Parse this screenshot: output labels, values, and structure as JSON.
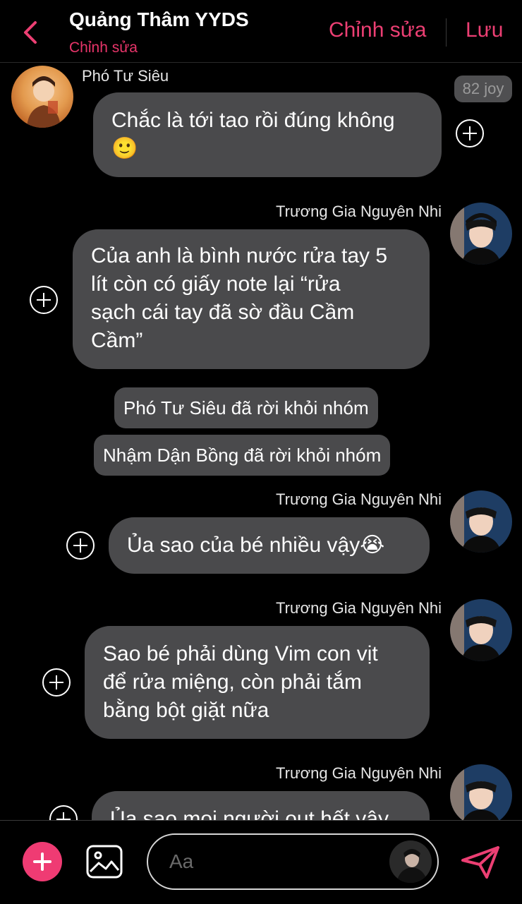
{
  "header": {
    "title": "Quảng Thâm YYDS",
    "subtitle": "Chỉnh sửa",
    "edit_label": "Chỉnh sửa",
    "save_label": "Lưu"
  },
  "messages": [
    {
      "sender": "Phó Tư Siêu",
      "lines": [
        "Chắc là tới tao rồi đúng không",
        "🙂"
      ],
      "reaction": "82 joy"
    },
    {
      "sender": "Trương Gia Nguyên Nhi",
      "lines": [
        "Của anh là bình nước rửa tay 5",
        "lít còn có giấy note lại “rửa",
        "sạch cái tay đã sờ đầu Cầm",
        "Cầm”"
      ]
    },
    {
      "system": "Phó Tư Siêu đã rời khỏi nhóm"
    },
    {
      "system": "Nhậm Dận Bồng đã rời khỏi nhóm"
    },
    {
      "sender": "Trương Gia Nguyên Nhi",
      "lines": [
        "Ủa sao của bé nhiều vậy😭"
      ]
    },
    {
      "sender": "Trương Gia Nguyên Nhi",
      "lines": [
        "Sao bé phải dùng Vim con vịt",
        "để rửa miệng, còn phải tắm",
        "bằng bột giặt nữa"
      ]
    },
    {
      "sender": "Trương Gia Nguyên Nhi",
      "lines": [
        "Ủa sao mọi người out hết vậy"
      ]
    }
  ],
  "composer": {
    "placeholder": "Aa"
  },
  "icons": {
    "back": "chevron-left-icon",
    "add": "plus-icon",
    "gallery": "image-icon",
    "send": "send-icon",
    "react": "add-reaction-icon"
  },
  "colors": {
    "accent": "#ec3f73",
    "bubble": "#4a4a4c",
    "background": "#000000"
  }
}
